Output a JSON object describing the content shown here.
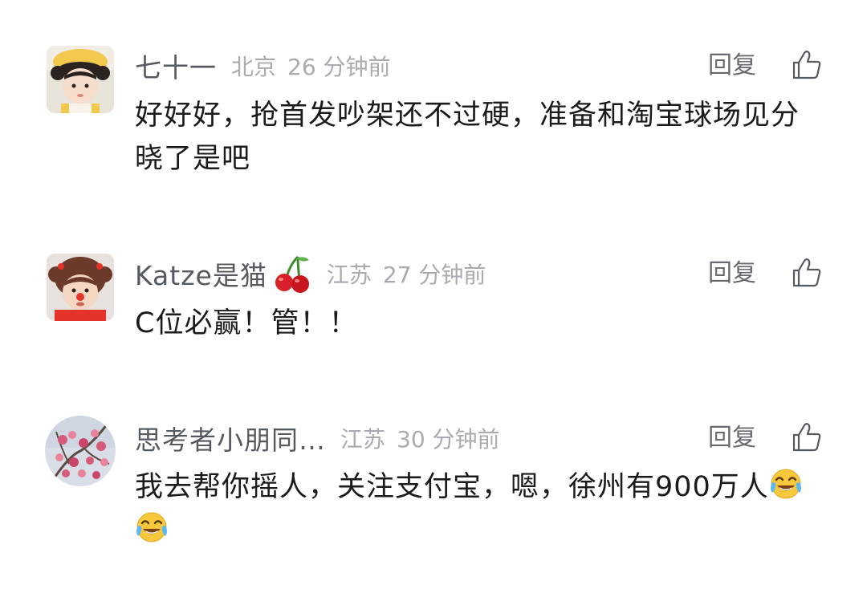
{
  "comments": [
    {
      "username": "七十一",
      "location": "北京",
      "time": "26 分钟前",
      "reply_label": "回复",
      "text": "好好好，抢首发吵架还不过硬，准备和淘宝球场见分晓了是吧",
      "avatar_icon": "girl-yellow-hat-avatar-icon",
      "like_icon": "thumbs-up-outline-icon"
    },
    {
      "username": "Katze是猫",
      "badge_icon": "cherry-icon",
      "location": "江苏",
      "time": "27 分钟前",
      "reply_label": "回复",
      "text": "C位必赢！管！！",
      "avatar_icon": "girl-red-nose-avatar-icon",
      "like_icon": "thumbs-up-outline-icon"
    },
    {
      "username": "思考者小朋同…",
      "location": "江苏",
      "time": "30 分钟前",
      "reply_label": "回复",
      "text": "我去帮你摇人，关注支付宝，嗯，徐州有900万人",
      "trailing_emojis": [
        "tears-of-joy-emoji-icon",
        "tears-of-joy-emoji-icon"
      ],
      "avatar_icon": "plum-blossom-avatar-icon",
      "like_icon": "thumbs-up-outline-icon"
    }
  ],
  "colors": {
    "username": "#555a61",
    "meta": "#a8abb0",
    "reply": "#666a70",
    "text": "#1b1b1b"
  }
}
